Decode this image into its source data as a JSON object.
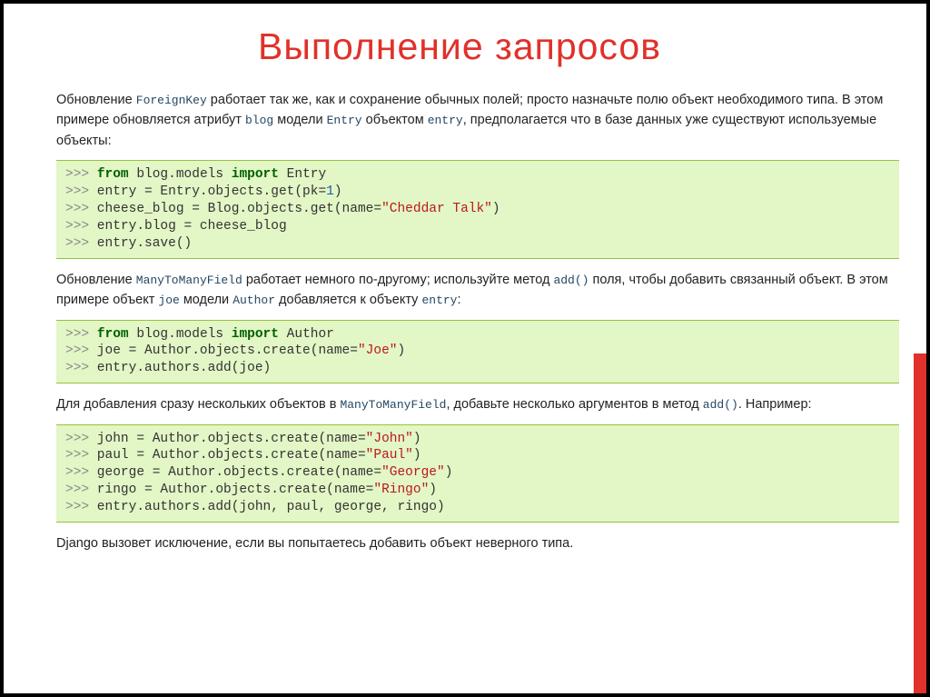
{
  "title": "Выполнение запросов",
  "para1": {
    "t0": "Обновление ",
    "c0": "ForeignKey",
    "t1": " работает так же, как и сохранение обычных полей; просто назначьте полю объект необходимого типа. В этом примере обновляется атрибут ",
    "c1": "blog",
    "t2": " модели ",
    "c2": "Entry",
    "t3": " объектом ",
    "c3": "entry",
    "t4": ", предполагается что в базе данных уже существуют используемые объекты:"
  },
  "code1": {
    "l1_from": "from",
    "l1_mod": " blog.models ",
    "l1_import": "import",
    "l1_rest": " Entry",
    "l2": " entry = Entry.objects.get(pk=",
    "l2_num": "1",
    "l2_end": ")",
    "l3": " cheese_blog = Blog.objects.get(name=",
    "l3_str": "\"Cheddar Talk\"",
    "l3_end": ")",
    "l4": " entry.blog = cheese_blog",
    "l5": " entry.save()"
  },
  "para2": {
    "t0": "Обновление ",
    "c0": "ManyToManyField",
    "t1": " работает немного по-другому; используйте метод ",
    "c1": "add()",
    "t2": " поля, чтобы добавить связанный объект. В этом примере объект ",
    "c2": "joe",
    "t3": " модели ",
    "c3": "Author",
    "t4": " добавляется к объекту ",
    "c4": "entry",
    "t5": ":"
  },
  "code2": {
    "l1_from": "from",
    "l1_mod": " blog.models ",
    "l1_import": "import",
    "l1_rest": " Author",
    "l2": " joe = Author.objects.create(name=",
    "l2_str": "\"Joe\"",
    "l2_end": ")",
    "l3": " entry.authors.add(joe)"
  },
  "para3": {
    "t0": "Для добавления сразу нескольких объектов в ",
    "c0": "ManyToManyField",
    "t1": ", добавьте несколько аргументов в метод ",
    "c1": "add()",
    "t2": ". Например:"
  },
  "code3": {
    "l1": " john = Author.objects.create(name=",
    "l1_str": "\"John\"",
    "l1_end": ")",
    "l2": " paul = Author.objects.create(name=",
    "l2_str": "\"Paul\"",
    "l2_end": ")",
    "l3": " george = Author.objects.create(name=",
    "l3_str": "\"George\"",
    "l3_end": ")",
    "l4": " ringo = Author.objects.create(name=",
    "l4_str": "\"Ringo\"",
    "l4_end": ")",
    "l5": " entry.authors.add(john, paul, george, ringo)"
  },
  "para4": "Django вызовет исключение, если вы попытаетесь добавить объект неверного типа.",
  "prompt": ">>>"
}
